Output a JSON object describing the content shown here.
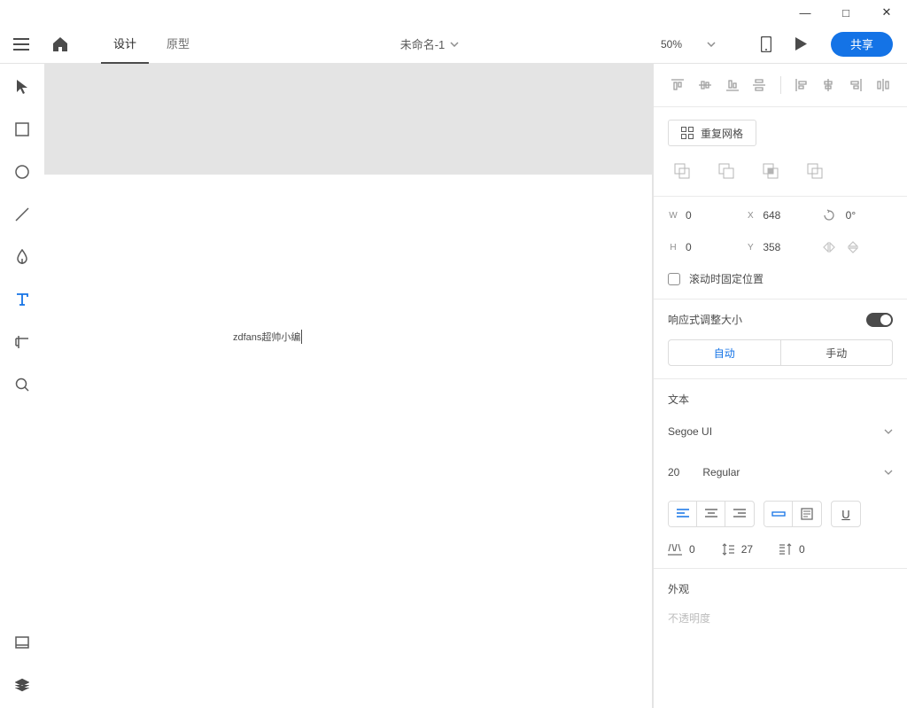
{
  "titlebar": {
    "min": "—",
    "max": "□",
    "close": "✕"
  },
  "topbar": {
    "modes": {
      "design": "设计",
      "prototype": "原型"
    },
    "doc_title": "未命名-1",
    "zoom": "50%",
    "share": "共享"
  },
  "canvas": {
    "text": "zdfans超帅小编"
  },
  "panel": {
    "repeat_grid": "重复网格",
    "dims": {
      "w_label": "W",
      "w": "0",
      "h_label": "H",
      "h": "0",
      "x_label": "X",
      "x": "648",
      "y_label": "Y",
      "y": "358",
      "rot": "0°"
    },
    "fix_scroll": "滚动时固定位置",
    "responsive_label": "响应式调整大小",
    "seg": {
      "auto": "自动",
      "manual": "手动"
    },
    "text_section": "文本",
    "font": "Segoe UI",
    "size": "20",
    "weight": "Regular",
    "spacing": {
      "letter": "0",
      "line": "27",
      "para": "0"
    },
    "appearance": "外观",
    "opacity": "不透明度"
  }
}
